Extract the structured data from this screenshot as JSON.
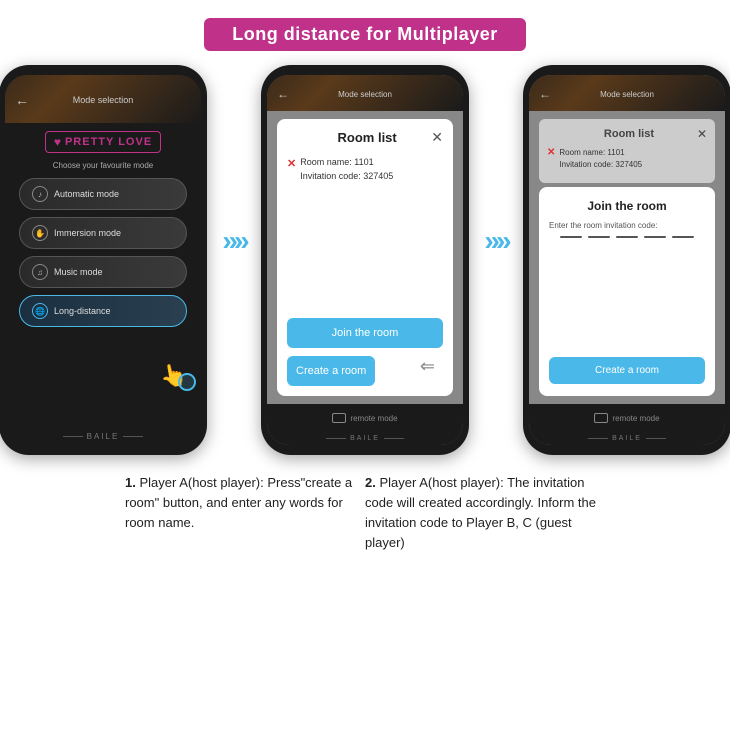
{
  "header": {
    "title": "Long distance for Multiplayer"
  },
  "phone1": {
    "mode_label": "Mode selection",
    "back": "←",
    "logo_text": "PRETTY LOVE",
    "logo_icon": "♥",
    "subtitle": "Choose your favourite mode",
    "buttons": [
      {
        "label": "Automatic mode",
        "icon": "♪"
      },
      {
        "label": "Immersion mode",
        "icon": "✋"
      },
      {
        "label": "Music mode",
        "icon": "♫"
      },
      {
        "label": "Long-distance",
        "icon": "🌐"
      }
    ],
    "footer": "BAILE"
  },
  "phone2": {
    "mode_label": "Mode selection",
    "back": "←",
    "room_list_title": "Room list",
    "close_btn": "✕",
    "room_name_label": "Room name: 1101",
    "invitation_label": "Invitation code: 327405",
    "join_btn": "Join the room",
    "create_btn": "Create a room",
    "remote_label": "remote mode",
    "footer": "BAILE"
  },
  "phone3": {
    "mode_label": "Mode selection",
    "back": "←",
    "room_list_title": "Room list",
    "close_btn": "✕",
    "room_name_label": "Room name: 1101",
    "invitation_label": "Invitation code: 327405",
    "join_room_title": "Join the room",
    "input_label": "Enter the room invitation code:",
    "create_btn": "Create a room",
    "remote_label": "remote mode",
    "footer": "BAILE"
  },
  "description1": {
    "number": "1.",
    "text": " Player A(host player): Press\"create a room\" button, and enter any words for room name."
  },
  "description2": {
    "number": "2.",
    "text": " Player A(host player): The invitation code will created accordingly. Inform the invitation code to Player B, C (guest player)"
  },
  "arrows": {
    "symbol": "»»"
  },
  "colors": {
    "accent": "#c0328a",
    "blue": "#4ab8e8",
    "phone_body": "#1a1a1a"
  }
}
